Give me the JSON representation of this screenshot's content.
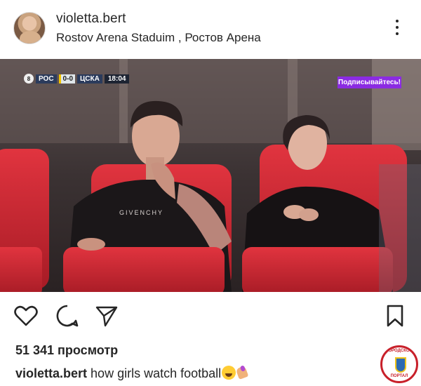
{
  "post": {
    "username": "violetta.bert",
    "location": "Rostov Arena Staduim , Ростов Арена"
  },
  "broadcast": {
    "round_badge": "8",
    "home_team": "РОС",
    "score": "0-0",
    "away_team": "ЦСКА",
    "clock": "18:04",
    "overlay_tag": "Подписывайтесь!"
  },
  "actions": {
    "like": "heart-icon",
    "comment": "comment-icon",
    "share": "send-icon",
    "save": "bookmark-icon"
  },
  "stats": {
    "views": "51 341 просмотр"
  },
  "caption": {
    "username": "violetta.bert",
    "text": "how girls watch football"
  },
  "watermark": {
    "top_text": "ГОРОДСКОЙ",
    "bottom_text": "ПОРТАЛ"
  }
}
